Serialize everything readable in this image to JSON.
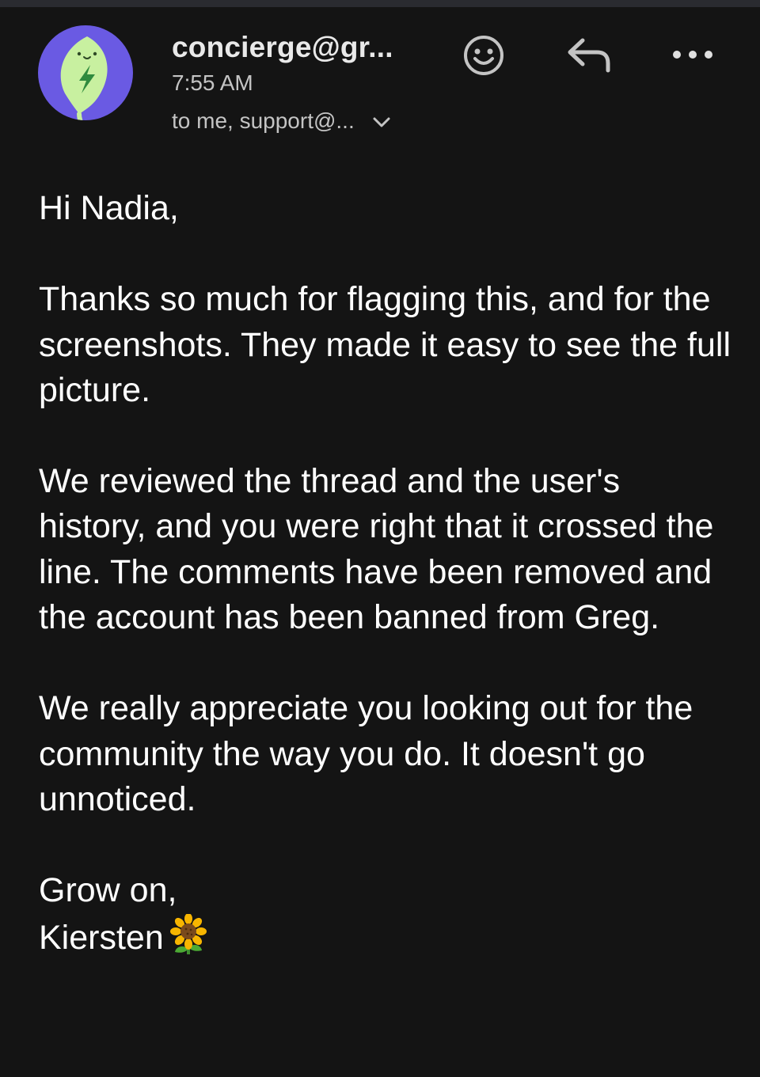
{
  "email": {
    "sender": "concierge@gr...",
    "time": "7:55 AM",
    "recipients": "to me, support@...",
    "greeting": "Hi Nadia,",
    "paragraphs": [
      "Thanks so much for flagging this, and for the screenshots. They made it easy to see the full picture.",
      "We reviewed the thread and the user's history, and you were right that it crossed the line. The comments have been removed and the account has been banned from Greg.",
      "We really appreciate you looking out for the community the way you do. It doesn't go unnoticed."
    ],
    "closing": "Grow on,",
    "signature": "Kiersten"
  },
  "icons": {
    "avatar": "leaf-lightning-logo",
    "emoji_reaction": "smiley-face-icon",
    "reply": "reply-arrow-icon",
    "more": "more-horizontal-icon",
    "expand_recipients": "chevron-down-icon",
    "signature_emoji": "sunflower-icon"
  },
  "colors": {
    "background": "#141414",
    "avatar_bg": "#6a5ae3",
    "leaf": "#c8f0a0",
    "text_primary": "#ffffff",
    "text_secondary": "#c4c4c4"
  }
}
